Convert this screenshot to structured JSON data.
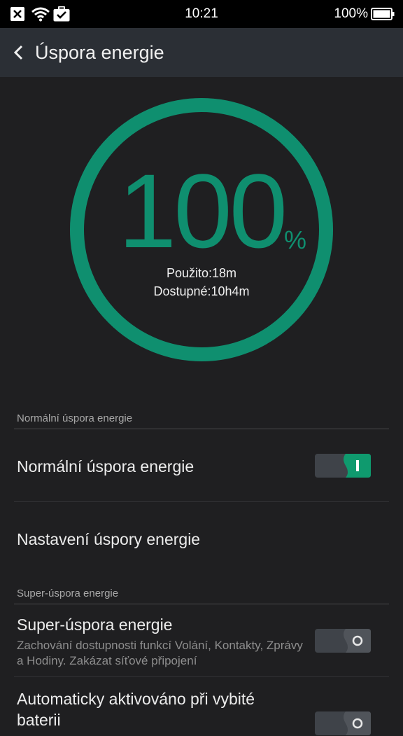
{
  "status_bar": {
    "time": "10:21",
    "battery_text": "100%",
    "icons": [
      "notification-close-icon",
      "wifi-icon",
      "briefcase-check-icon",
      "battery-icon"
    ]
  },
  "header": {
    "title": "Úspora energie",
    "back_icon": "chevron-left-icon"
  },
  "gauge": {
    "value": "100",
    "percent_sign": "%",
    "level": 1.0,
    "used": "Použito:18m",
    "available": "Dostupné:10h4m",
    "ring_color": "#0f8f6f"
  },
  "section_normal": {
    "header": "Normální úspora energie",
    "toggle_row_title": "Normální úspora energie",
    "toggle_on": true,
    "settings_row_title": "Nastavení úspory energie"
  },
  "section_super": {
    "header": "Super-úspora energie",
    "toggle_row_title": "Super-úspora energie",
    "toggle_row_subtitle": "Zachování dostupnosti funkcí Volání, Kontakty, Zprávy a Hodiny. Zakázat síťové připojení",
    "toggle_on": false,
    "auto_row_title": "Automaticky aktivováno při vybité baterii"
  },
  "colors": {
    "accent": "#0f8f6f",
    "toggle_on": "#0f9a6e",
    "toggle_off": "#3f4349",
    "background": "#1f1f21",
    "app_bar": "#2b2f35"
  }
}
